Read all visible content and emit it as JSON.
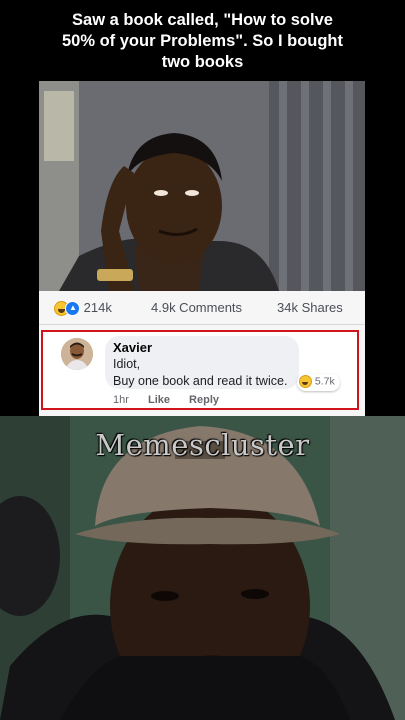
{
  "caption": {
    "line1": "Saw a book called, \"How to solve",
    "line2": "50% of your Problems\". So I bought",
    "line3": "two books"
  },
  "post": {
    "reaction_count": "214k",
    "comments_count": "4.9k Comments",
    "shares_count": "34k Shares",
    "reaction_icons": [
      "haha-emoji",
      "like-icon"
    ]
  },
  "comment": {
    "author": "Xavier",
    "text_line1": "Idiot,",
    "text_line2": "Buy one book and read it twice.",
    "reaction_count": "5.7k",
    "time": "1hr",
    "like_label": "Like",
    "reply_label": "Reply",
    "highlight_color": "#d0141d"
  },
  "watermark": "Memescluster"
}
